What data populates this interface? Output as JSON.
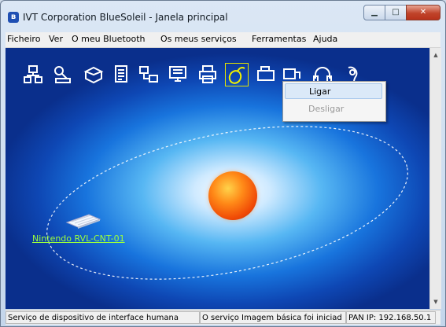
{
  "window": {
    "title": "IVT Corporation BlueSoleil - Janela principal",
    "icon": "bluetooth-icon",
    "buttons": {
      "minimize": "minimize-icon",
      "maximize": "maximize-icon",
      "close": "close-icon"
    }
  },
  "menu": {
    "items": [
      "Ficheiro",
      "Ver",
      "O meu Bluetooth",
      "Os meus serviços",
      "Ferramentas",
      "Ajuda"
    ]
  },
  "toolbar": {
    "icons": [
      "network-service-icon",
      "dialup-service-icon",
      "fax-service-icon",
      "file-transfer-icon",
      "lan-access-icon",
      "pim-sync-icon",
      "printer-service-icon",
      "hid-mouse-icon",
      "fax-machine-icon",
      "serial-port-icon",
      "headset-icon",
      "audio-gateway-icon"
    ],
    "selected": "hid-mouse-icon"
  },
  "context_menu": {
    "items": [
      {
        "label": "Ligar",
        "enabled": true
      },
      {
        "label": "Desligar",
        "enabled": false
      }
    ]
  },
  "device": {
    "name": "Nintendo RVL-CNT-01",
    "icon": "keyboard-device-icon"
  },
  "center": {
    "icon": "local-device-sun-icon"
  },
  "status": {
    "cells": [
      "Serviço de dispositivo de interface humana",
      "O serviço Imagem básica foi iniciad",
      "PAN IP: 192.168.50.1"
    ]
  },
  "colors": {
    "device_label": "#9cff3c",
    "orbit": "#ffffff",
    "selection_outline": "#e4e400"
  }
}
